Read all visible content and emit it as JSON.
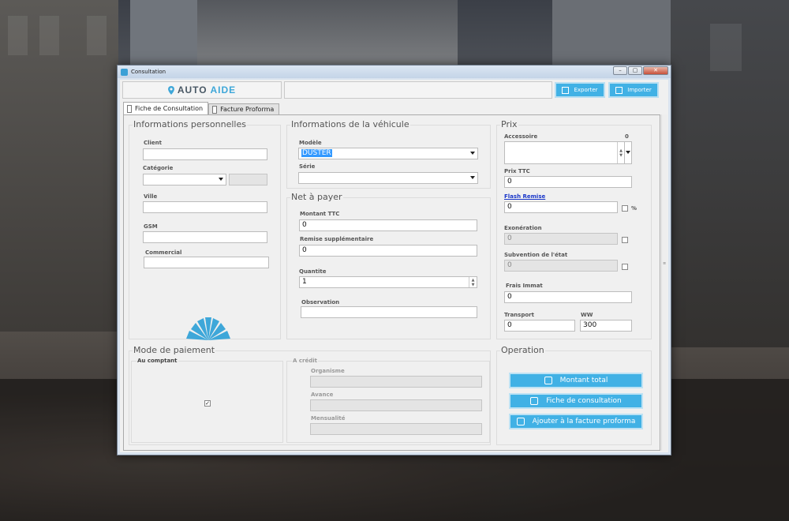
{
  "window": {
    "title": "Consultation",
    "controls": [
      "–",
      "▢",
      "✕"
    ]
  },
  "logo": {
    "part1": "AUTO",
    "part2": "AIDE"
  },
  "toolbar": {
    "export_label": "Exporter",
    "import_label": "Importer"
  },
  "tabs": [
    {
      "label": "Fiche de Consultation"
    },
    {
      "label": "Facture Proforma"
    }
  ],
  "personal": {
    "title": "Informations personnelles",
    "client_label": "Client",
    "client_value": "",
    "category_label": "Catégorie",
    "category_value": "",
    "city_label": "Ville",
    "city_value": "",
    "gsm_label": "GSM",
    "gsm_value": "",
    "commercial_label": "Commercial",
    "commercial_value": ""
  },
  "vehicle": {
    "title": "Informations de la véhicule",
    "model_label": "Modèle",
    "model_value": "DUSTER",
    "series_label": "Série",
    "series_value": ""
  },
  "net": {
    "title": "Net à payer",
    "montant_label": "Montant TTC",
    "montant_value": "0",
    "remise_label": "Remise supplémentaire",
    "remise_value": "0",
    "quantite_label": "Quantite",
    "quantite_value": "1",
    "observation_label": "Observation",
    "observation_value": ""
  },
  "prix": {
    "title": "Prix",
    "accessoire_label": "Accessoire",
    "accessoire_count": "0",
    "prix_ttc_label": "Prix TTC",
    "prix_ttc_value": "0",
    "flash_label": "Flash Remise",
    "flash_value": "0",
    "pct": "%",
    "exoneration_label": "Exonération",
    "exoneration_value": "0",
    "subvention_label": "Subvention de l'état",
    "subvention_value": "0",
    "frais_label": "Frais Immat",
    "frais_value": "0",
    "transport_label": "Transport",
    "transport_value": "0",
    "ww_label": "WW",
    "ww_value": "300"
  },
  "paiement": {
    "title": "Mode de paiement",
    "comptant_label": "Au comptant",
    "comptant_checked": "✓",
    "credit_label": "A crédit",
    "organisme_label": "Organisme",
    "avance_label": "Avance",
    "mensualite_label": "Mensualité"
  },
  "operation": {
    "title": "Operation",
    "btn_total": "Montant total",
    "btn_fiche": "Fiche de consultation",
    "btn_proforma": "Ajouter à la facture proforma"
  },
  "colors": {
    "accent": "#41b1e5",
    "link": "#1a37c9"
  }
}
